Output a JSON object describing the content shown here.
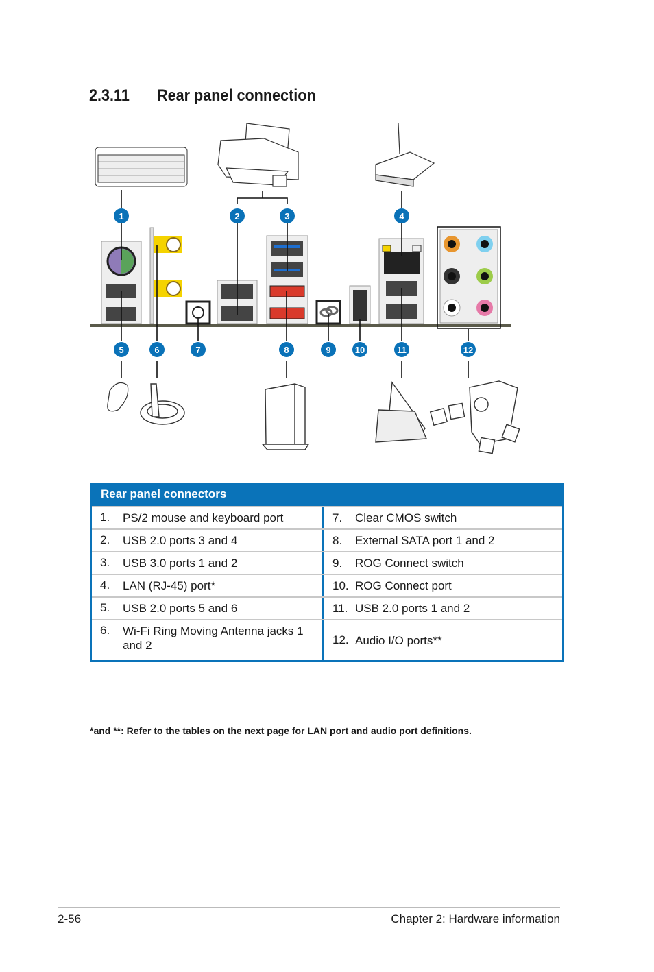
{
  "section": {
    "number": "2.3.11",
    "title": "Rear panel connection"
  },
  "diagram": {
    "callouts": [
      "1",
      "2",
      "3",
      "4",
      "5",
      "6",
      "7",
      "8",
      "9",
      "10",
      "11",
      "12"
    ],
    "badge_color": "#0a72b8",
    "devices": [
      "keyboard",
      "printer",
      "router",
      "mouse",
      "antenna",
      "external-drive",
      "laptop",
      "speakers"
    ]
  },
  "table": {
    "title": "Rear panel connectors",
    "border_color": "#0a73b9",
    "rows": [
      {
        "ln": "1.",
        "lt": "PS/2 mouse and keyboard port",
        "rn": "7.",
        "rt": "Clear CMOS switch"
      },
      {
        "ln": "2.",
        "lt": "USB 2.0 ports 3 and 4",
        "rn": "8.",
        "rt": "External SATA port 1 and 2"
      },
      {
        "ln": "3.",
        "lt": "USB 3.0 ports 1 and 2",
        "rn": "9.",
        "rt": "ROG Connect switch"
      },
      {
        "ln": "4.",
        "lt": "LAN (RJ-45) port*",
        "rn": "10.",
        "rt": "ROG Connect port"
      },
      {
        "ln": "5.",
        "lt": "USB 2.0 ports 5 and 6",
        "rn": "11.",
        "rt": "USB 2.0 ports 1 and 2"
      },
      {
        "ln": "6.",
        "lt": "Wi-Fi Ring Moving Antenna jacks 1 and 2",
        "rn": "12.",
        "rt": "Audio I/O ports**"
      }
    ]
  },
  "footnote": "*and **: Refer to the tables on the next page for LAN port and audio port definitions.",
  "footer": {
    "page": "2-56",
    "chapter": "Chapter 2: Hardware information"
  }
}
